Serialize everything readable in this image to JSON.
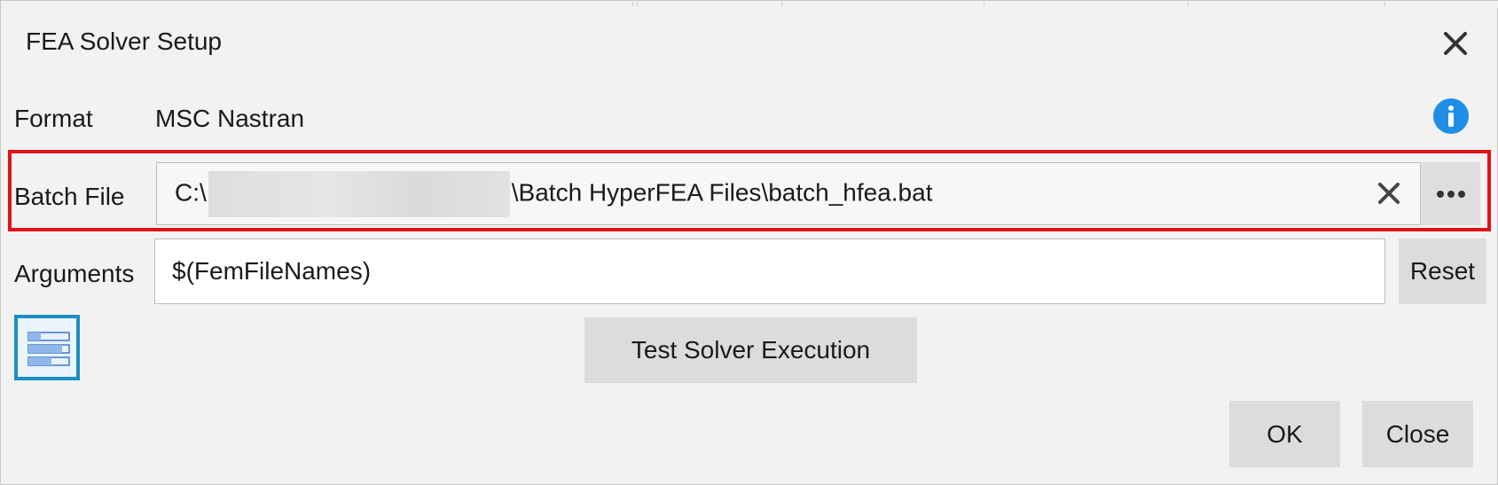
{
  "dialog": {
    "title": "FEA Solver Setup",
    "close_icon": "close-icon"
  },
  "format": {
    "label": "Format",
    "value": "MSC Nastran",
    "info_icon": "info-icon",
    "info_color": "#1e8ee6"
  },
  "batch_file": {
    "label": "Batch File",
    "value_prefix": "C:\\",
    "value_suffix": "\\Batch HyperFEA Files\\batch_hfea.bat",
    "clear_icon": "clear-icon",
    "browse_label": "•••",
    "highlight_color": "#e0121a"
  },
  "arguments": {
    "label": "Arguments",
    "value": "$(FemFileNames)",
    "reset_label": "Reset"
  },
  "actions": {
    "table_icon": "table-view-icon",
    "test_label": "Test Solver Execution",
    "ok_label": "OK",
    "close_label": "Close"
  }
}
